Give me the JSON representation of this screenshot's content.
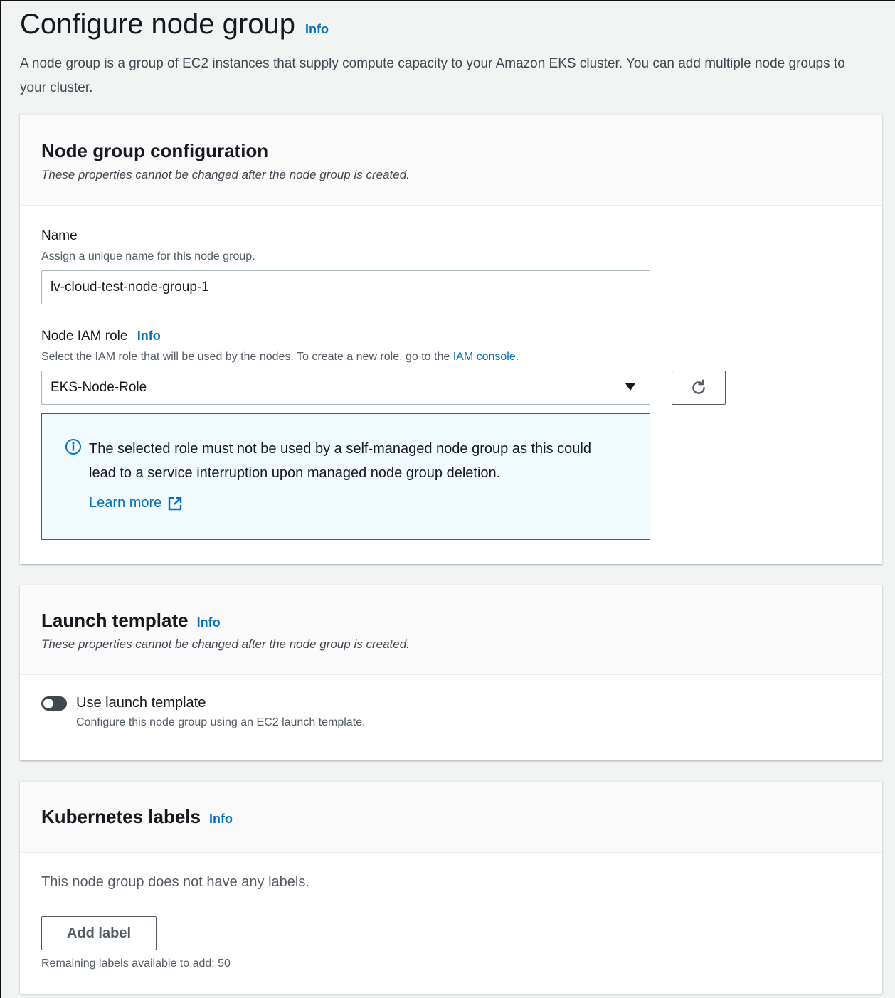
{
  "header": {
    "title": "Configure node group",
    "info": "Info",
    "description": "A node group is a group of EC2 instances that supply compute capacity to your Amazon EKS cluster. You can add multiple node groups to your cluster."
  },
  "node_group_config": {
    "title": "Node group configuration",
    "subtitle": "These properties cannot be changed after the node group is created.",
    "name": {
      "label": "Name",
      "description": "Assign a unique name for this node group.",
      "value": "lv-cloud-test-node-group-1"
    },
    "iam_role": {
      "label": "Node IAM role",
      "info": "Info",
      "description_prefix": "Select the IAM role that will be used by the nodes. To create a new role, go to the ",
      "description_link": "IAM console",
      "description_suffix": ".",
      "selected": "EKS-Node-Role"
    },
    "alert": {
      "text": "The selected role must not be used by a self-managed node group as this could lead to a service interruption upon managed node group deletion.",
      "link": "Learn more"
    }
  },
  "launch_template": {
    "title": "Launch template",
    "info": "Info",
    "subtitle": "These properties cannot be changed after the node group is created.",
    "toggle_label": "Use launch template",
    "toggle_description": "Configure this node group using an EC2 launch template.",
    "toggle_on": false
  },
  "kubernetes_labels": {
    "title": "Kubernetes labels",
    "info": "Info",
    "empty_text": "This node group does not have any labels.",
    "add_button": "Add label",
    "remaining": "Remaining labels available to add: 50"
  },
  "colors": {
    "link": "#0073bb",
    "alert_bg": "#f1faff",
    "alert_border": "#0073bb",
    "toggle_off": "#414750"
  }
}
